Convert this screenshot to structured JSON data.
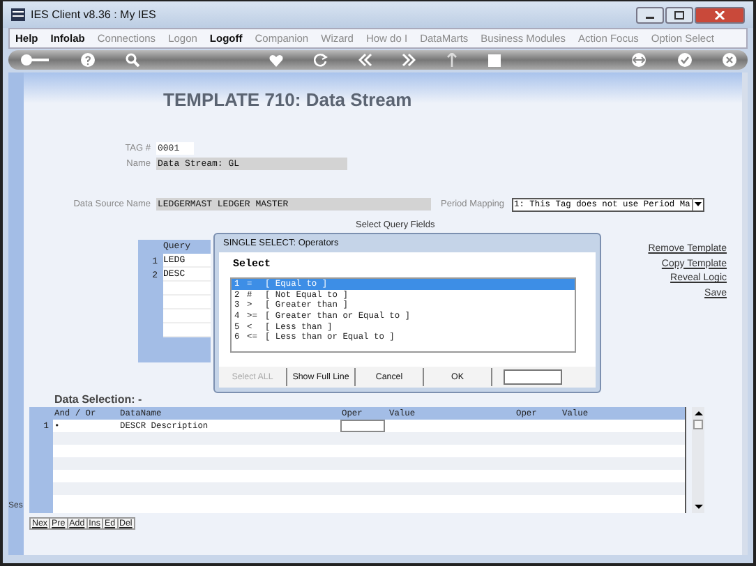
{
  "window": {
    "title": "IES Client v8.36 : My IES"
  },
  "menu": [
    {
      "label": "Help",
      "disabled": false
    },
    {
      "label": "Infolab",
      "disabled": false
    },
    {
      "label": "Connections",
      "disabled": true
    },
    {
      "label": "Logon",
      "disabled": true
    },
    {
      "label": "Logoff",
      "disabled": false
    },
    {
      "label": "Companion",
      "disabled": true
    },
    {
      "label": "Wizard",
      "disabled": true
    },
    {
      "label": "How do I",
      "disabled": true
    },
    {
      "label": "DataMarts",
      "disabled": true
    },
    {
      "label": "Business Modules",
      "disabled": true
    },
    {
      "label": "Action Focus",
      "disabled": true
    },
    {
      "label": "Option Select",
      "disabled": true
    }
  ],
  "page": {
    "title": "TEMPLATE 710: Data Stream"
  },
  "form": {
    "tag_label": "TAG #",
    "tag_value": "0001",
    "name_label": "Name",
    "name_value": "Data Stream: GL",
    "source_label": "Data Source Name",
    "source_value": "LEDGERMAST LEDGER MASTER",
    "period_label": "Period Mapping",
    "period_value": "1: This Tag does not use Period Ma"
  },
  "query_fields": {
    "heading": "Select Query Fields",
    "column_1": "Query",
    "rows": [
      {
        "number": "1",
        "value": "LEDG"
      },
      {
        "number": "2",
        "value": "DESC"
      }
    ]
  },
  "links": [
    "Remove Template",
    "Copy Template",
    "Reveal Logic",
    "Save"
  ],
  "dialog": {
    "title": "SINGLE SELECT: Operators",
    "heading": "Select",
    "options": [
      {
        "number": "1",
        "symbol": "=",
        "label": "[ Equal to ]",
        "selected": true
      },
      {
        "number": "2",
        "symbol": "#",
        "label": "[ Not Equal to ]",
        "selected": false
      },
      {
        "number": "3",
        "symbol": ">",
        "label": "[ Greater than ]",
        "selected": false
      },
      {
        "number": "4",
        "symbol": ">=",
        "label": "[ Greater than or Equal to ]",
        "selected": false
      },
      {
        "number": "5",
        "symbol": "<",
        "label": "[ Less than ]",
        "selected": false
      },
      {
        "number": "6",
        "symbol": "<=",
        "label": "[ Less than or Equal to ]",
        "selected": false
      }
    ],
    "buttons": [
      {
        "label": "Select ALL",
        "disabled": true
      },
      {
        "label": "Show Full Line",
        "disabled": false
      },
      {
        "label": "Cancel",
        "disabled": false
      },
      {
        "label": "OK",
        "disabled": false
      }
    ]
  },
  "data_selection": {
    "title": "Data Selection: -",
    "columns": [
      "And / Or",
      "DataName",
      "Oper",
      "Value",
      "Oper",
      "Value"
    ],
    "rows": [
      {
        "number": "1",
        "and_or": "•",
        "data_name": "DESCR Description"
      }
    ]
  },
  "side_label": "Ses",
  "nav_buttons": [
    "Nex",
    "Pre",
    "Add",
    "Ins",
    "Ed",
    "Del"
  ]
}
